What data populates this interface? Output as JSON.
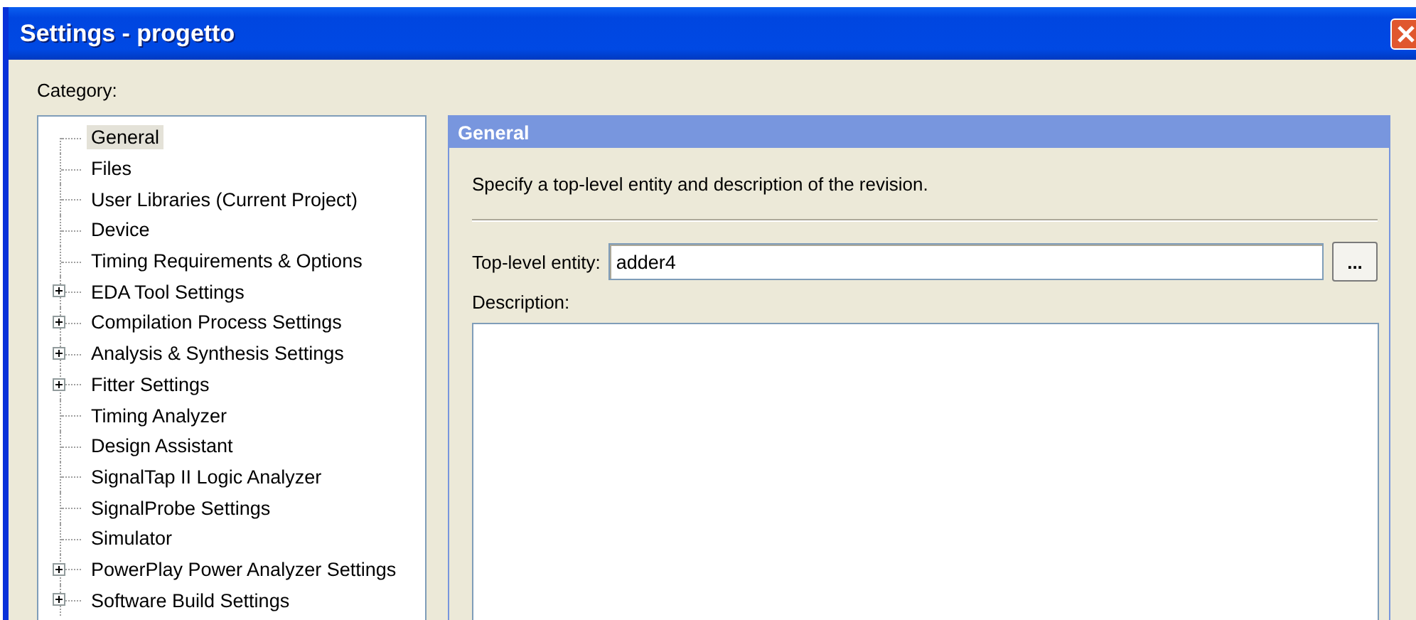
{
  "window": {
    "title": "Settings - progetto"
  },
  "category_label": "Category:",
  "tree": [
    {
      "label": "General",
      "expandable": false,
      "selected": true
    },
    {
      "label": "Files",
      "expandable": false,
      "selected": false
    },
    {
      "label": "User Libraries (Current Project)",
      "expandable": false,
      "selected": false
    },
    {
      "label": "Device",
      "expandable": false,
      "selected": false
    },
    {
      "label": "Timing Requirements & Options",
      "expandable": false,
      "selected": false
    },
    {
      "label": "EDA Tool Settings",
      "expandable": true,
      "selected": false
    },
    {
      "label": "Compilation Process Settings",
      "expandable": true,
      "selected": false
    },
    {
      "label": "Analysis & Synthesis Settings",
      "expandable": true,
      "selected": false
    },
    {
      "label": "Fitter Settings",
      "expandable": true,
      "selected": false
    },
    {
      "label": "Timing Analyzer",
      "expandable": false,
      "selected": false
    },
    {
      "label": "Design Assistant",
      "expandable": false,
      "selected": false
    },
    {
      "label": "SignalTap II Logic Analyzer",
      "expandable": false,
      "selected": false
    },
    {
      "label": "SignalProbe Settings",
      "expandable": false,
      "selected": false
    },
    {
      "label": "Simulator",
      "expandable": false,
      "selected": false
    },
    {
      "label": "PowerPlay Power Analyzer Settings",
      "expandable": true,
      "selected": false
    },
    {
      "label": "Software Build Settings",
      "expandable": true,
      "selected": false
    }
  ],
  "panel": {
    "title": "General",
    "description": "Specify a top-level entity and description of the revision.",
    "top_level_entity": {
      "label": "Top-level entity:",
      "value": "adder4",
      "browse_button": "..."
    },
    "description_label": "Description:"
  }
}
